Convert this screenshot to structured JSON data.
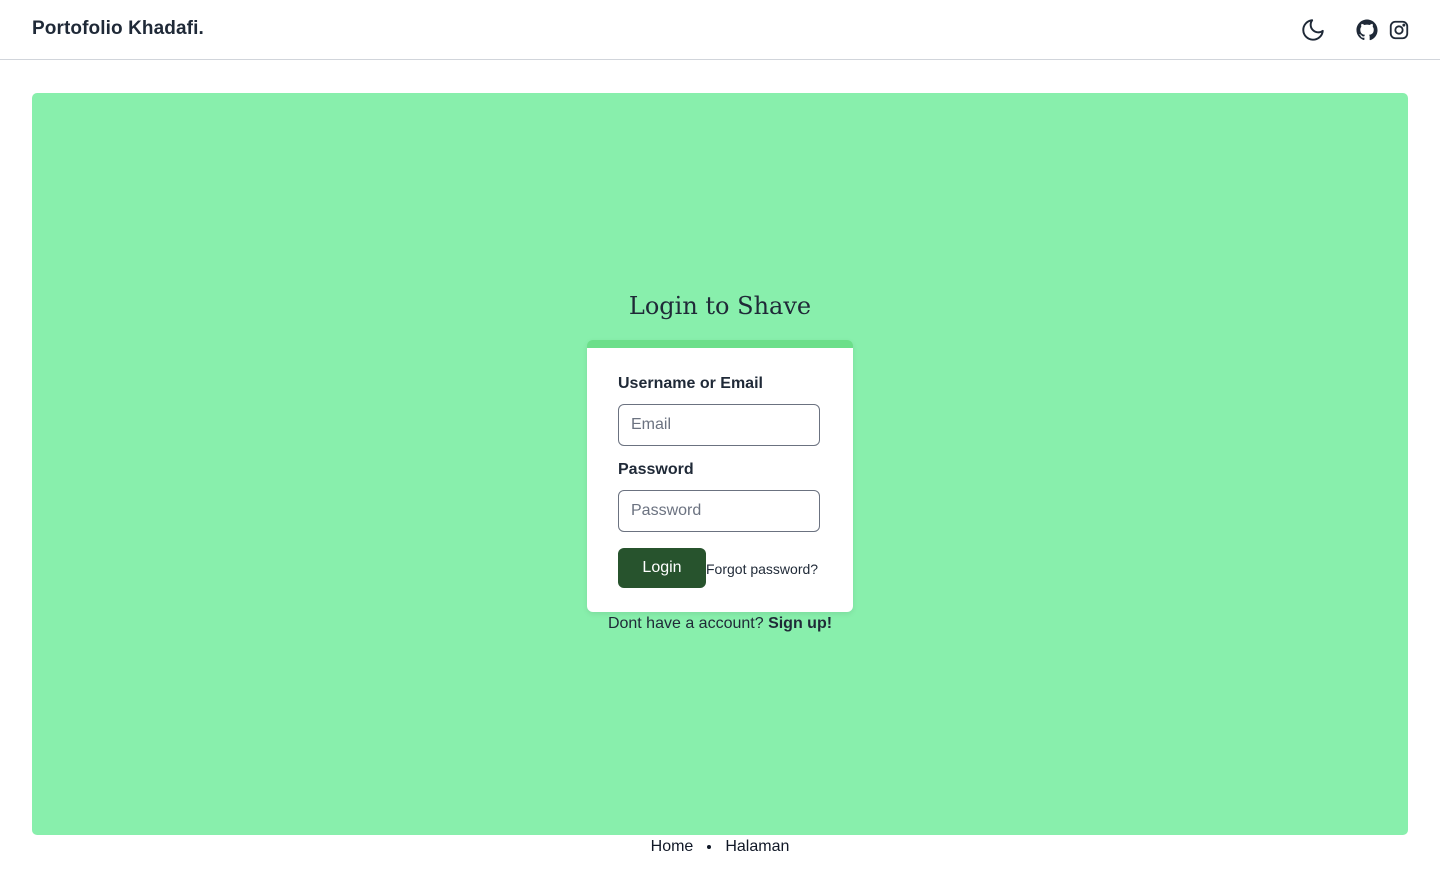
{
  "navbar": {
    "brand": "Portofolio Khadafi.",
    "icons": [
      "moon-icon",
      "github-icon",
      "instagram-icon"
    ]
  },
  "login": {
    "title": "Login to Shave",
    "username_label": "Username or Email",
    "email_placeholder": "Email",
    "password_label": "Password",
    "password_placeholder": "Password",
    "login_button": "Login",
    "forgot_link": "Forgot password?",
    "signup_prompt": "Dont have a account?",
    "signup_link": "Sign up!"
  },
  "breadcrumb": {
    "items": [
      "Home",
      "Halaman"
    ]
  },
  "colors": {
    "hero_bg": "#88efac",
    "card_accent": "#6cdf8a",
    "button_bg": "#27532d",
    "text": "#1f2937"
  }
}
